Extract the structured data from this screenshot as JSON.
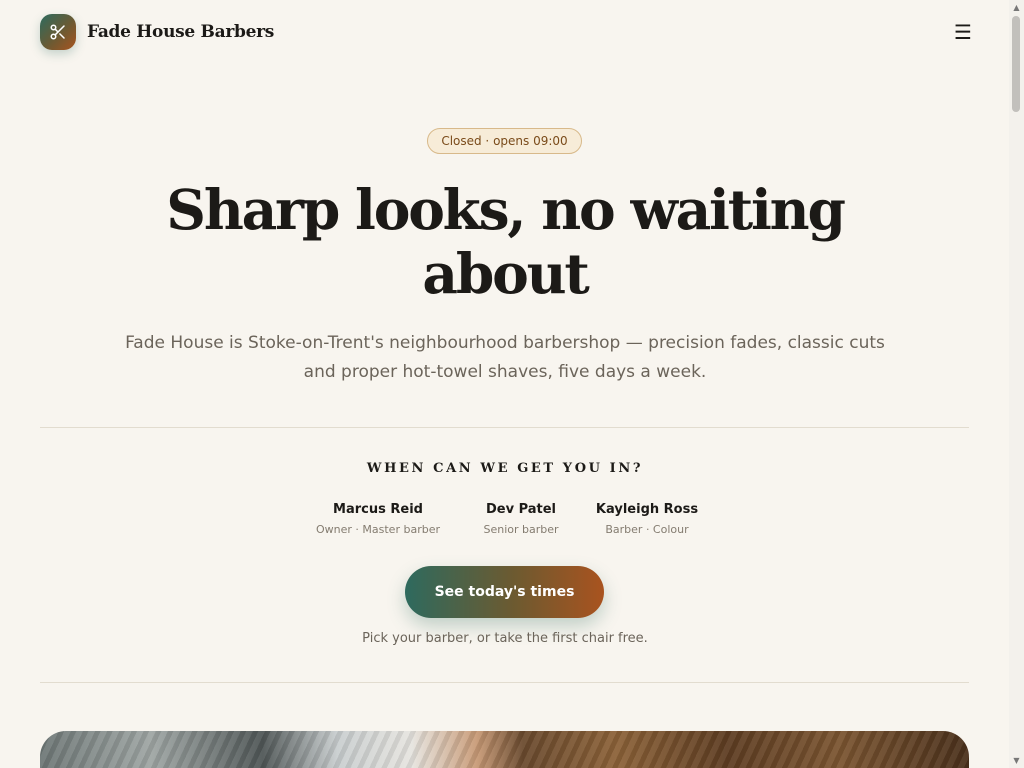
{
  "header": {
    "brand_name": "Fade House Barbers",
    "logo_icon": "scissors-icon",
    "menu_icon": "hamburger-menu-icon",
    "menu_glyph": "☰"
  },
  "hero": {
    "status_badge": "Closed · opens 09:00",
    "title": "Sharp looks, no waiting about",
    "subtitle": "Fade House is Stoke-on-Trent's neighbourhood barbershop — precision fades, classic cuts and proper hot-towel shaves, five days a week."
  },
  "booking": {
    "heading": "WHEN CAN WE GET YOU IN?",
    "barbers": [
      {
        "name": "Marcus Reid",
        "role": "Owner · Master barber"
      },
      {
        "name": "Dev Patel",
        "role": "Senior barber"
      },
      {
        "name": "Kayleigh Ross",
        "role": "Barber · Colour"
      }
    ],
    "cta_label": "See today's times",
    "cta_hint": "Pick your barber, or take the first chair free."
  },
  "scrollbar": {
    "up_glyph": "▲",
    "down_glyph": "▼"
  },
  "colors": {
    "background": "#f8f5ef",
    "accent_teal": "#2e6a5e",
    "accent_rust": "#a9531f",
    "badge_border": "#d8b98a",
    "badge_text": "#7a4b1a",
    "text_primary": "#1c1a17",
    "text_muted": "#6b645a"
  }
}
